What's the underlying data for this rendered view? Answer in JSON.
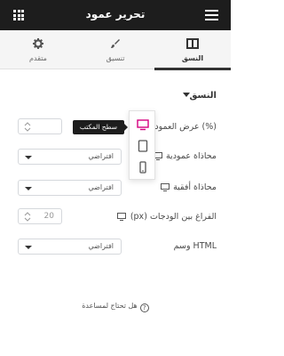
{
  "header": {
    "title": "تحرير عمود",
    "menu_icon": "hamburger-icon",
    "apps_icon": "apps-grid-icon"
  },
  "tabs": [
    {
      "label": "النسق",
      "icon": "columns-icon",
      "active": true
    },
    {
      "label": "تنسيق",
      "icon": "brush-icon",
      "active": false
    },
    {
      "label": "متقدم",
      "icon": "gear-icon",
      "active": false
    }
  ],
  "section": {
    "title": "النسق"
  },
  "fields": {
    "column_width": {
      "label": "عرض العمود (%)",
      "value": ""
    },
    "vertical_align": {
      "label": "محاذاة عمودية",
      "value": "افتراضي"
    },
    "horizontal_align": {
      "label": "محاذاة أفقية",
      "value": "افتراضي"
    },
    "widgets_space": {
      "label": "الفراغ بين الودجات",
      "unit": "(px)",
      "placeholder": "20"
    },
    "html_tag": {
      "label": "وسم HTML",
      "value": "افتراضي"
    }
  },
  "responsive_popup": {
    "tooltip": "سطح المكتب",
    "devices": [
      "desktop-icon",
      "tablet-icon",
      "mobile-icon"
    ],
    "active": "desktop-icon",
    "accent": "#d5007f"
  },
  "help": {
    "label": "هل تحتاج لمساعدة",
    "icon": "?"
  }
}
